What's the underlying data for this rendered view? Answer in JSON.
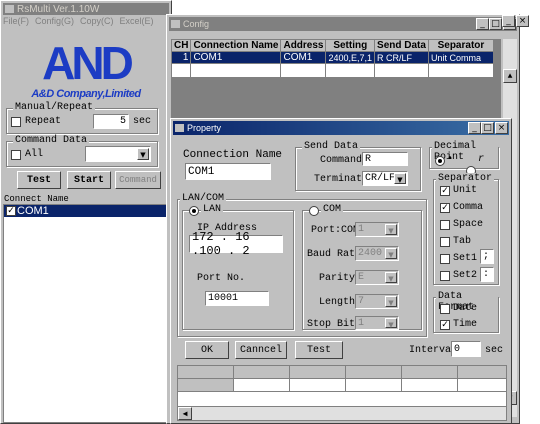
{
  "main_window": {
    "title": "RsMulti Ver.1.10W",
    "menu": [
      "File(F)",
      "Config(G)",
      "Copy(C)",
      "Excel(E)"
    ],
    "logo_text": "A&D Company,Limited",
    "manual_repeat": {
      "label": "Manual/Repeat",
      "repeat_label": "Repeat",
      "interval_value": "5",
      "unit": "sec"
    },
    "command_data": {
      "label": "Command Data",
      "all_label": "All",
      "value": ""
    },
    "buttons": {
      "test": "Test",
      "start": "Start",
      "command": "Command"
    },
    "connect_name_label": "Connect Name",
    "connect_list": [
      "COM1"
    ]
  },
  "config_window": {
    "title": "Config",
    "columns": [
      "CH",
      "Connection Name",
      "Address",
      "Setting",
      "Send Data",
      "Separator"
    ],
    "rows": [
      {
        "ch": "1",
        "name": "COM1",
        "address": "COM1",
        "setting": "2400,E,7,1",
        "send_data": "R  CR/LF",
        "separator": "Unit  Comma"
      }
    ]
  },
  "property_window": {
    "title": "Property",
    "connection_name_label": "Connection Name",
    "connection_name_value": "COM1",
    "send_data": {
      "label": "Send Data",
      "command_label": "Command",
      "command_value": "R",
      "terminator_label": "Terminator",
      "terminator_value": "CR/LF"
    },
    "decimal_point": {
      "label": "Decimal Point",
      "opt1": "•",
      "opt2": "r"
    },
    "separator": {
      "label": "Separator",
      "unit": "Unit",
      "comma": "Comma",
      "space": "Space",
      "tab": "Tab",
      "set1": "Set1",
      "set1_value": ";",
      "set2": "Set2",
      "set2_value": ":"
    },
    "lan_com": {
      "label": "LAN/COM",
      "lan_label": "LAN",
      "ip_label": "IP Address",
      "ip_value": "172 . 16 .100 . 2",
      "port_label": "Port No.",
      "port_value": "10001",
      "com_label": "COM",
      "port_com_label": "Port:COM",
      "port_com_value": "1",
      "baud_label": "Baud Rate",
      "baud_value": "2400",
      "parity_label": "Parity",
      "parity_value": "E",
      "length_label": "Length",
      "length_value": "7",
      "stopbit_label": "Stop Bit",
      "stopbit_value": "1"
    },
    "data_format": {
      "label": "Data Format",
      "date": "Date",
      "time": "Time"
    },
    "buttons": {
      "ok": "OK",
      "cancel": "Canncel",
      "test": "Test"
    },
    "interval_label": "Interval",
    "interval_value": "0",
    "interval_unit": "sec"
  }
}
